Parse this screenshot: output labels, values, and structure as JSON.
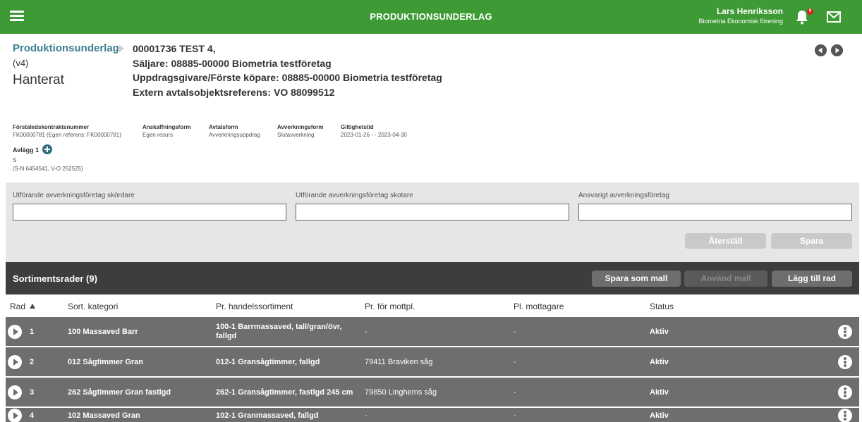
{
  "topbar": {
    "title": "PRODUKTIONSUNDERLAG",
    "user_name": "Lars Henriksson",
    "user_org": "Biometria Ekonomisk förening",
    "notification_count": "9"
  },
  "header": {
    "breadcrumb": "Produktionsunderlag",
    "version": "(v4)",
    "state": "Hanterat",
    "lines": [
      "00001736 TEST 4,",
      "Säljare: 08885-00000 Biometria testföretag",
      "Uppdragsgivare/Förste köpare: 08885-00000 Biometria testföretag",
      "Extern avtalsobjektsreferens: VO 88099512"
    ]
  },
  "info": {
    "columns": [
      {
        "label": "Förstaledskontraktsnummer",
        "value": "FK00000781 (Egen referens: FK00000781)"
      },
      {
        "label": "Anskaffningsform",
        "value": "Egen resurs"
      },
      {
        "label": "Avtalsform",
        "value": "Avverkningsuppdrag"
      },
      {
        "label": "Avverkningsform",
        "value": "Slutavverkning"
      },
      {
        "label": "Giltighetstid",
        "value": "2023-01-26 - - 2023-04-30"
      }
    ],
    "avlagg_label": "Avlägg 1",
    "avlagg_lines": [
      "S",
      "(S-N 6454541, V-O 252525)"
    ]
  },
  "form": {
    "fields": [
      {
        "label": "Utförande avverkningsföretag skördare",
        "value": ""
      },
      {
        "label": "Utförande avverkningsföretag skotare",
        "value": ""
      },
      {
        "label": "Ansvarigt avverkningsföretag",
        "value": ""
      }
    ],
    "reset_label": "Återställ",
    "save_label": "Spara"
  },
  "section": {
    "title": "Sortimentsrader (9)",
    "save_template_label": "Spara som mall",
    "use_template_label": "Använd mall",
    "add_row_label": "Lägg till rad"
  },
  "table": {
    "headers": [
      "Rad",
      "Sort. kategori",
      "Pr. handelssortiment",
      "Pr. för mottpl.",
      "Pl. mottagare",
      "Status"
    ],
    "rows": [
      {
        "rad": "1",
        "kategori": "100 Massaved Barr",
        "handelssortiment": "100-1 Barrmassaved, tall/gran/övr, fallgd",
        "mottpl": "-",
        "mottagare": "-",
        "status": "Aktiv"
      },
      {
        "rad": "2",
        "kategori": "012 Sågtimmer Gran",
        "handelssortiment": "012-1 Gransågtimmer, fallgd",
        "mottpl": "79411 Braviken såg",
        "mottagare": "-",
        "status": "Aktiv"
      },
      {
        "rad": "3",
        "kategori": "262 Sågtimmer Gran fastlgd",
        "handelssortiment": "262-1 Gransågtimmer, fastlgd 245 cm",
        "mottpl": "79850 Linghems såg",
        "mottagare": "-",
        "status": "Aktiv"
      },
      {
        "rad": "4",
        "kategori": "102 Massaved Gran",
        "handelssortiment": "102-1 Granmassaved, fallgd",
        "mottpl": "-",
        "mottagare": "-",
        "status": "Aktiv"
      }
    ]
  },
  "colors": {
    "brand_green": "#3d9a34",
    "link_teal": "#3d7f8f",
    "row_grey": "#6e6e6e",
    "section_dark": "#3d3d3d"
  }
}
